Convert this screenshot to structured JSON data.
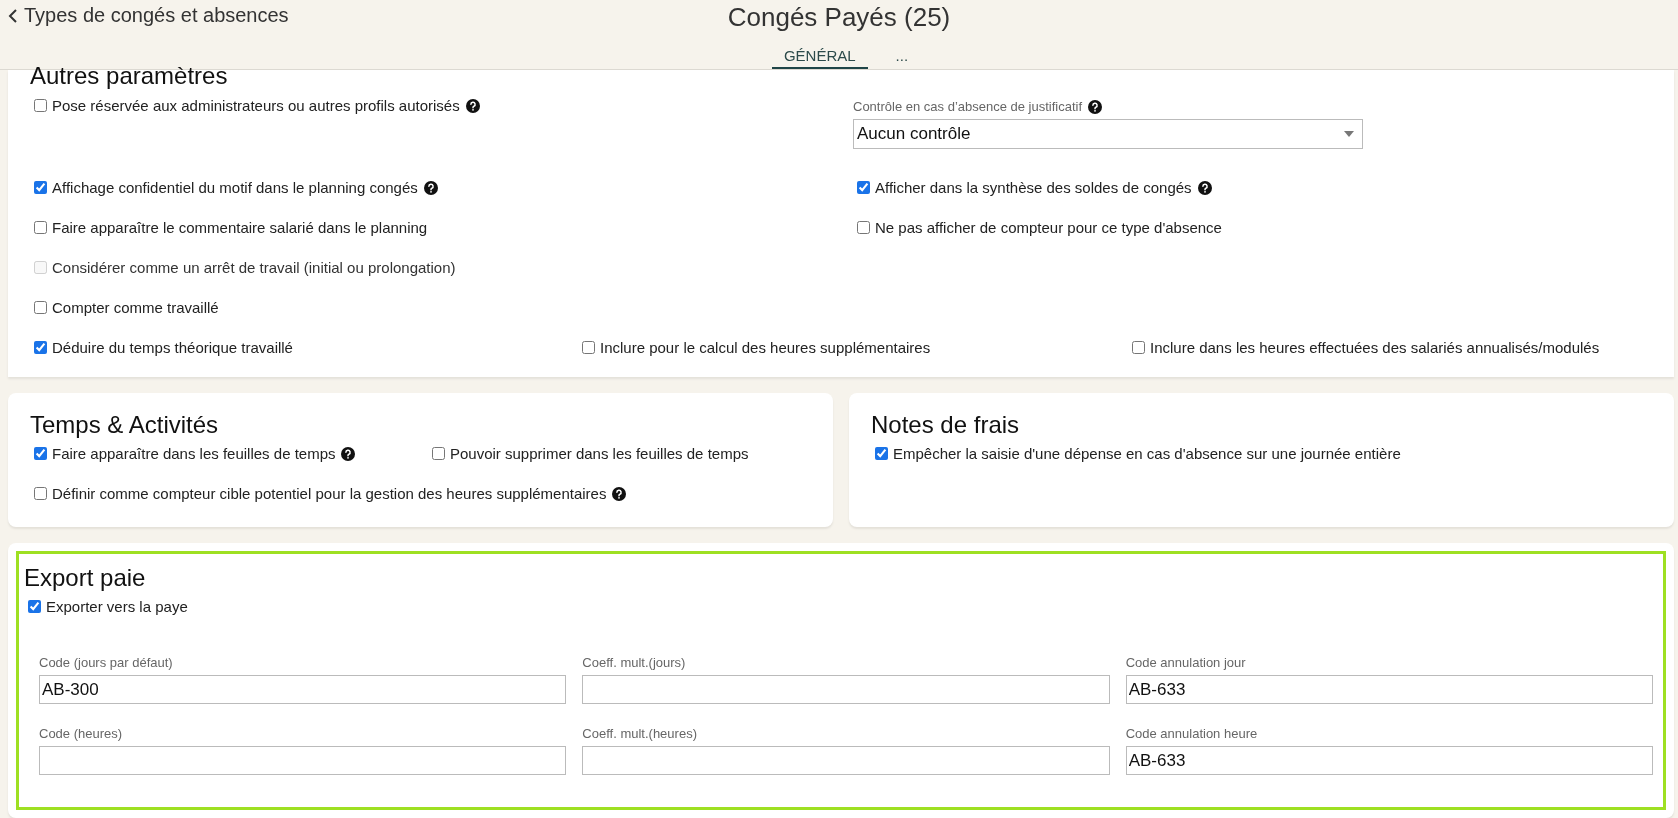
{
  "header": {
    "back_link": "Types de congés et absences",
    "title": "Congés Payés (25)",
    "tabs": [
      {
        "label": "GÉNÉRAL",
        "selected": true
      },
      {
        "label": "...",
        "selected": false
      }
    ]
  },
  "autres_parametres": {
    "title": "Autres paramètres",
    "rows": [
      [
        {
          "kind": "checkbox",
          "label": "Pose réservée aux administrateurs ou autres profils autorisés",
          "checked": false,
          "disabled": false,
          "help": true
        },
        {
          "kind": "select",
          "label": "Contrôle en cas d’absence de justificatif",
          "value": "Aucun contrôle",
          "help": true
        }
      ],
      [
        {
          "kind": "checkbox",
          "label": "Affichage confidentiel du motif dans le planning congés",
          "checked": true,
          "disabled": false,
          "help": true
        },
        {
          "kind": "checkbox",
          "label": "Afficher dans la synthèse des soldes de congés",
          "checked": true,
          "disabled": false,
          "help": true
        }
      ],
      [
        {
          "kind": "checkbox",
          "label": "Faire apparaître le commentaire salarié dans le planning",
          "checked": false,
          "disabled": false,
          "help": false
        },
        {
          "kind": "checkbox",
          "label": "Ne pas afficher de compteur pour ce type d'absence",
          "checked": false,
          "disabled": false,
          "help": false
        }
      ],
      [
        {
          "kind": "checkbox",
          "label": "Considérer comme un arrêt de travail (initial ou prolongation)",
          "checked": false,
          "disabled": true,
          "help": false
        }
      ],
      [
        {
          "kind": "checkbox",
          "label": "Compter comme travaillé",
          "checked": false,
          "disabled": false,
          "help": false
        }
      ]
    ],
    "bottom_row": [
      {
        "kind": "checkbox",
        "label": "Déduire du temps théorique travaillé",
        "checked": true,
        "disabled": false,
        "help": false
      },
      {
        "kind": "checkbox",
        "label": "Inclure pour le calcul des heures supplémentaires",
        "checked": false,
        "disabled": false,
        "help": false
      },
      {
        "kind": "checkbox",
        "label": "Inclure dans les heures effectuées des salariés annualisés/modulés",
        "checked": false,
        "disabled": false,
        "help": false
      }
    ]
  },
  "temps_activites": {
    "title": "Temps & Activités",
    "rows": [
      [
        {
          "kind": "checkbox",
          "label": "Faire apparaître dans les feuilles de temps",
          "checked": true,
          "disabled": false,
          "help": true
        },
        {
          "kind": "checkbox",
          "label": "Pouvoir supprimer dans les feuilles de temps",
          "checked": false,
          "disabled": false,
          "help": false
        }
      ],
      [
        {
          "kind": "checkbox",
          "label": "Définir comme compteur cible potentiel pour la gestion des heures supplémentaires",
          "checked": false,
          "disabled": false,
          "help": true
        }
      ]
    ]
  },
  "notes_de_frais": {
    "title": "Notes de frais",
    "rows": [
      [
        {
          "kind": "checkbox",
          "label": "Empêcher la saisie d'une dépense en cas d'absence sur une journée entière",
          "checked": true,
          "disabled": false,
          "help": false
        }
      ]
    ]
  },
  "export_paie": {
    "title": "Export paie",
    "export": {
      "kind": "checkbox",
      "label": "Exporter vers la paye",
      "checked": true,
      "disabled": false,
      "help": false
    },
    "fields": [
      {
        "label": "Code (jours par défaut)",
        "value": "AB-300"
      },
      {
        "label": "Coeff. mult.(jours)"
      },
      {
        "label": "Code annulation jour",
        "value": "AB-633"
      },
      {
        "label": "Code (heures)"
      },
      {
        "label": "Coeff. mult.(heures)"
      },
      {
        "label": "Code annulation heure",
        "value": "AB-633"
      }
    ]
  }
}
